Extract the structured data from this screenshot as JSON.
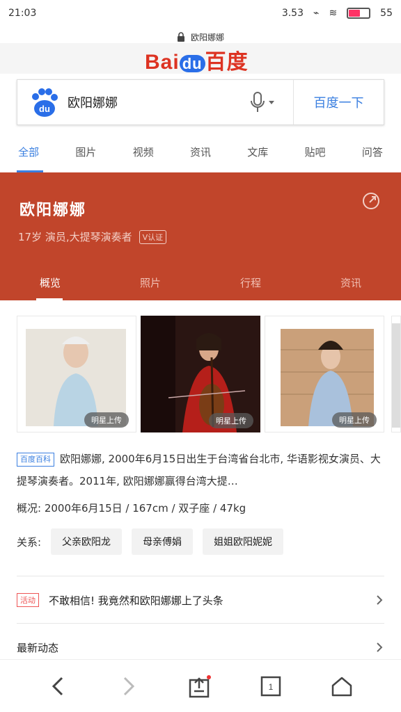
{
  "status": {
    "time": "21:03",
    "speed": "3.53",
    "battery": "55",
    "battery_level": 0.55
  },
  "url": {
    "text": "欧阳娜娜"
  },
  "logo": {
    "left": "Bai",
    "mid": "du",
    "right": "百度"
  },
  "search": {
    "query": "欧阳娜娜",
    "button": "百度一下"
  },
  "nav": {
    "tabs": [
      "全部",
      "图片",
      "视频",
      "资讯",
      "文库",
      "贴吧",
      "问答"
    ]
  },
  "banner": {
    "name": "欧阳娜娜",
    "subtitle": "17岁  演员,大提琴演奏者",
    "verify": "V认证",
    "tabs": [
      "概览",
      "照片",
      "行程",
      "资讯"
    ]
  },
  "photos": {
    "tag": "明星上传"
  },
  "summary": {
    "source": "百度百科",
    "text": "欧阳娜娜, 2000年6月15日出生于台湾省台北市, 华语影视女演员、大提琴演奏者。2011年, 欧阳娜娜赢得台湾大提…",
    "info": "概况: 2000年6月15日 / 167cm / 双子座 / 47kg",
    "relations_label": "关系:",
    "relations": [
      "父亲欧阳龙",
      "母亲傅娟",
      "姐姐欧阳妮妮"
    ]
  },
  "activity": {
    "badge": "活动",
    "text": "不敢相信! 我竟然和欧阳娜娜上了头条"
  },
  "latest": {
    "title": "最新动态"
  },
  "colors": {
    "brand_red": "#c1452b",
    "accent_blue": "#3a7fe0"
  }
}
